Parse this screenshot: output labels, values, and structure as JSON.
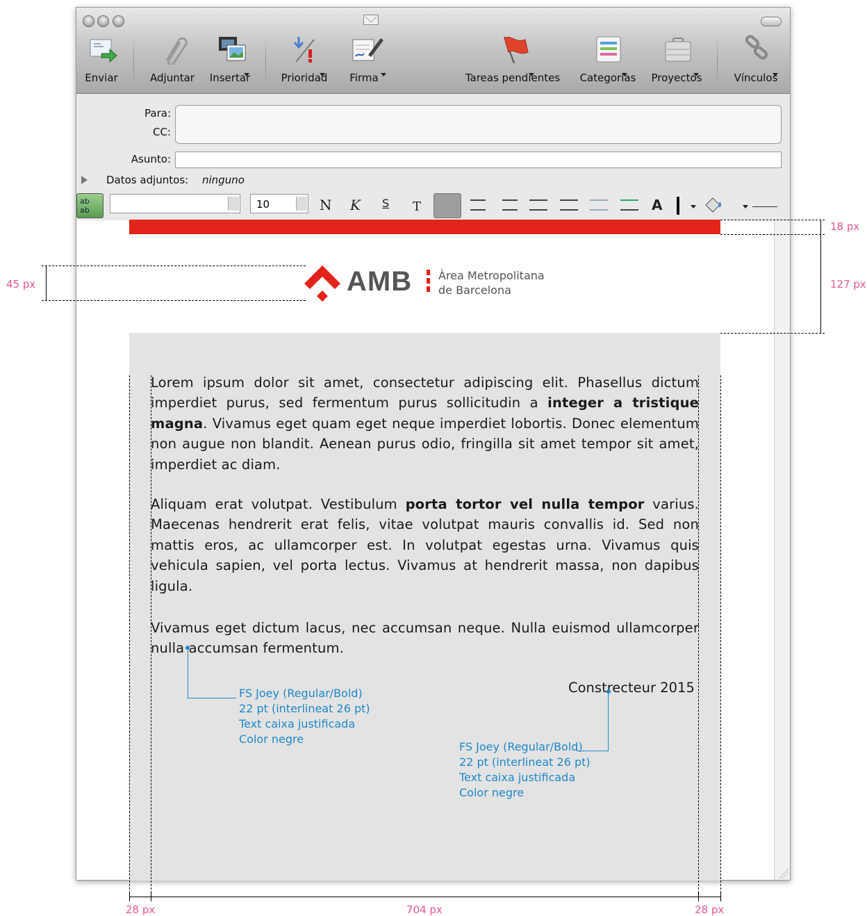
{
  "toolbar": {
    "items": [
      {
        "label": "Enviar",
        "icon": "send-icon"
      },
      {
        "label": "Adjuntar",
        "icon": "paperclip-icon"
      },
      {
        "label": "Insertar",
        "icon": "media-icon"
      },
      {
        "label": "Prioridad",
        "icon": "priority-icon"
      },
      {
        "label": "Firma",
        "icon": "signature-icon"
      },
      {
        "label": "Tareas pendientes",
        "icon": "flag-icon"
      },
      {
        "label": "Categorías",
        "icon": "categories-icon"
      },
      {
        "label": "Proyectos",
        "icon": "briefcase-icon"
      },
      {
        "label": "Vínculos",
        "icon": "chain-link-icon"
      }
    ]
  },
  "header": {
    "to_label": "Para:",
    "cc_label": "CC:",
    "subject_label": "Asunto:",
    "attachments_label": "Datos adjuntos:",
    "attachments_value": "ninguno"
  },
  "format": {
    "font_size": "10",
    "bold": "N",
    "italic": "K",
    "strike": "S",
    "text": "T"
  },
  "logo": {
    "brand": "AMB",
    "line1": "Àrea Metropolitana",
    "line2": "de Barcelona"
  },
  "body": {
    "p1_a": "Lorem ipsum dolor sit amet, consectetur adipiscing elit. Phasellus dictum imperdiet purus, sed fermentum purus sollicitudin a ",
    "p1_b": "integer a tristique magna",
    "p1_c": ". Vivamus eget quam eget neque imperdiet lobortis. Donec elementum non augue non blandit. Aenean purus odio, fringilla sit amet tempor sit amet, imperdiet ac diam.",
    "p2_a": "Aliquam erat volutpat. Vestibulum ",
    "p2_b": "porta tortor vel nulla tempor",
    "p2_c": " varius. Maecenas hendrerit erat felis, vitae volutpat mauris convallis id. Sed non mattis eros, ac ullamcorper est. In volutpat egestas urna. Vivamus quis vehicula sapien, vel porta lectus. Vivamus at hendrerit massa, non dapibus ligula.",
    "p3": "Vivamus eget dictum lacus, nec accumsan neque. Nulla euismod ullamcorper nulla accumsan fermentum.",
    "signature": "Constrecteur 2015"
  },
  "notes": {
    "left": [
      "FS Joey (Regular/Bold)",
      "22 pt (interlineat 26 pt)",
      "Text caixa justificada",
      "Color negre"
    ],
    "right": [
      "FS Joey (Regular/Bold)",
      "22 pt (interlineat 26 pt)",
      "Text caixa justificada",
      "Color negre"
    ]
  },
  "dimensions": {
    "top_bar": "18 px",
    "header_zone": "127 px",
    "logo_height": "45 px",
    "margin_left": "28 px",
    "content_width": "704 px",
    "margin_right": "28 px"
  },
  "colors": {
    "accent_red": "#e3241b",
    "note_blue": "#1e88c8",
    "guide_pink": "#e8579a",
    "box_gray": "#e3e3e3"
  }
}
